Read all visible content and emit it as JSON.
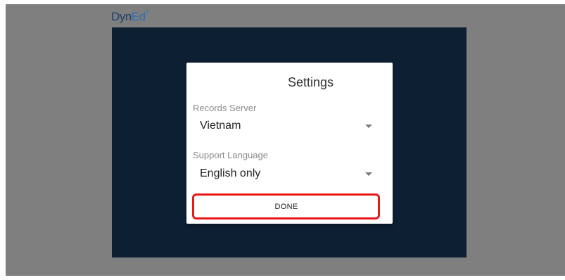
{
  "brand": {
    "logo_dyn": "Dyn",
    "logo_ed": "Ed",
    "logo_mark": "®"
  },
  "dialog": {
    "title": "Settings",
    "records_server": {
      "label": "Records Server",
      "value": "Vietnam"
    },
    "support_language": {
      "label": "Support Language",
      "value": "English only"
    },
    "done_label": "DONE"
  },
  "colors": {
    "background": "#7f7f7f",
    "app_frame": "#0d1f33",
    "highlight": "#e81818",
    "brand_dark": "#1c3e6b",
    "brand_light": "#2a6fb8"
  }
}
